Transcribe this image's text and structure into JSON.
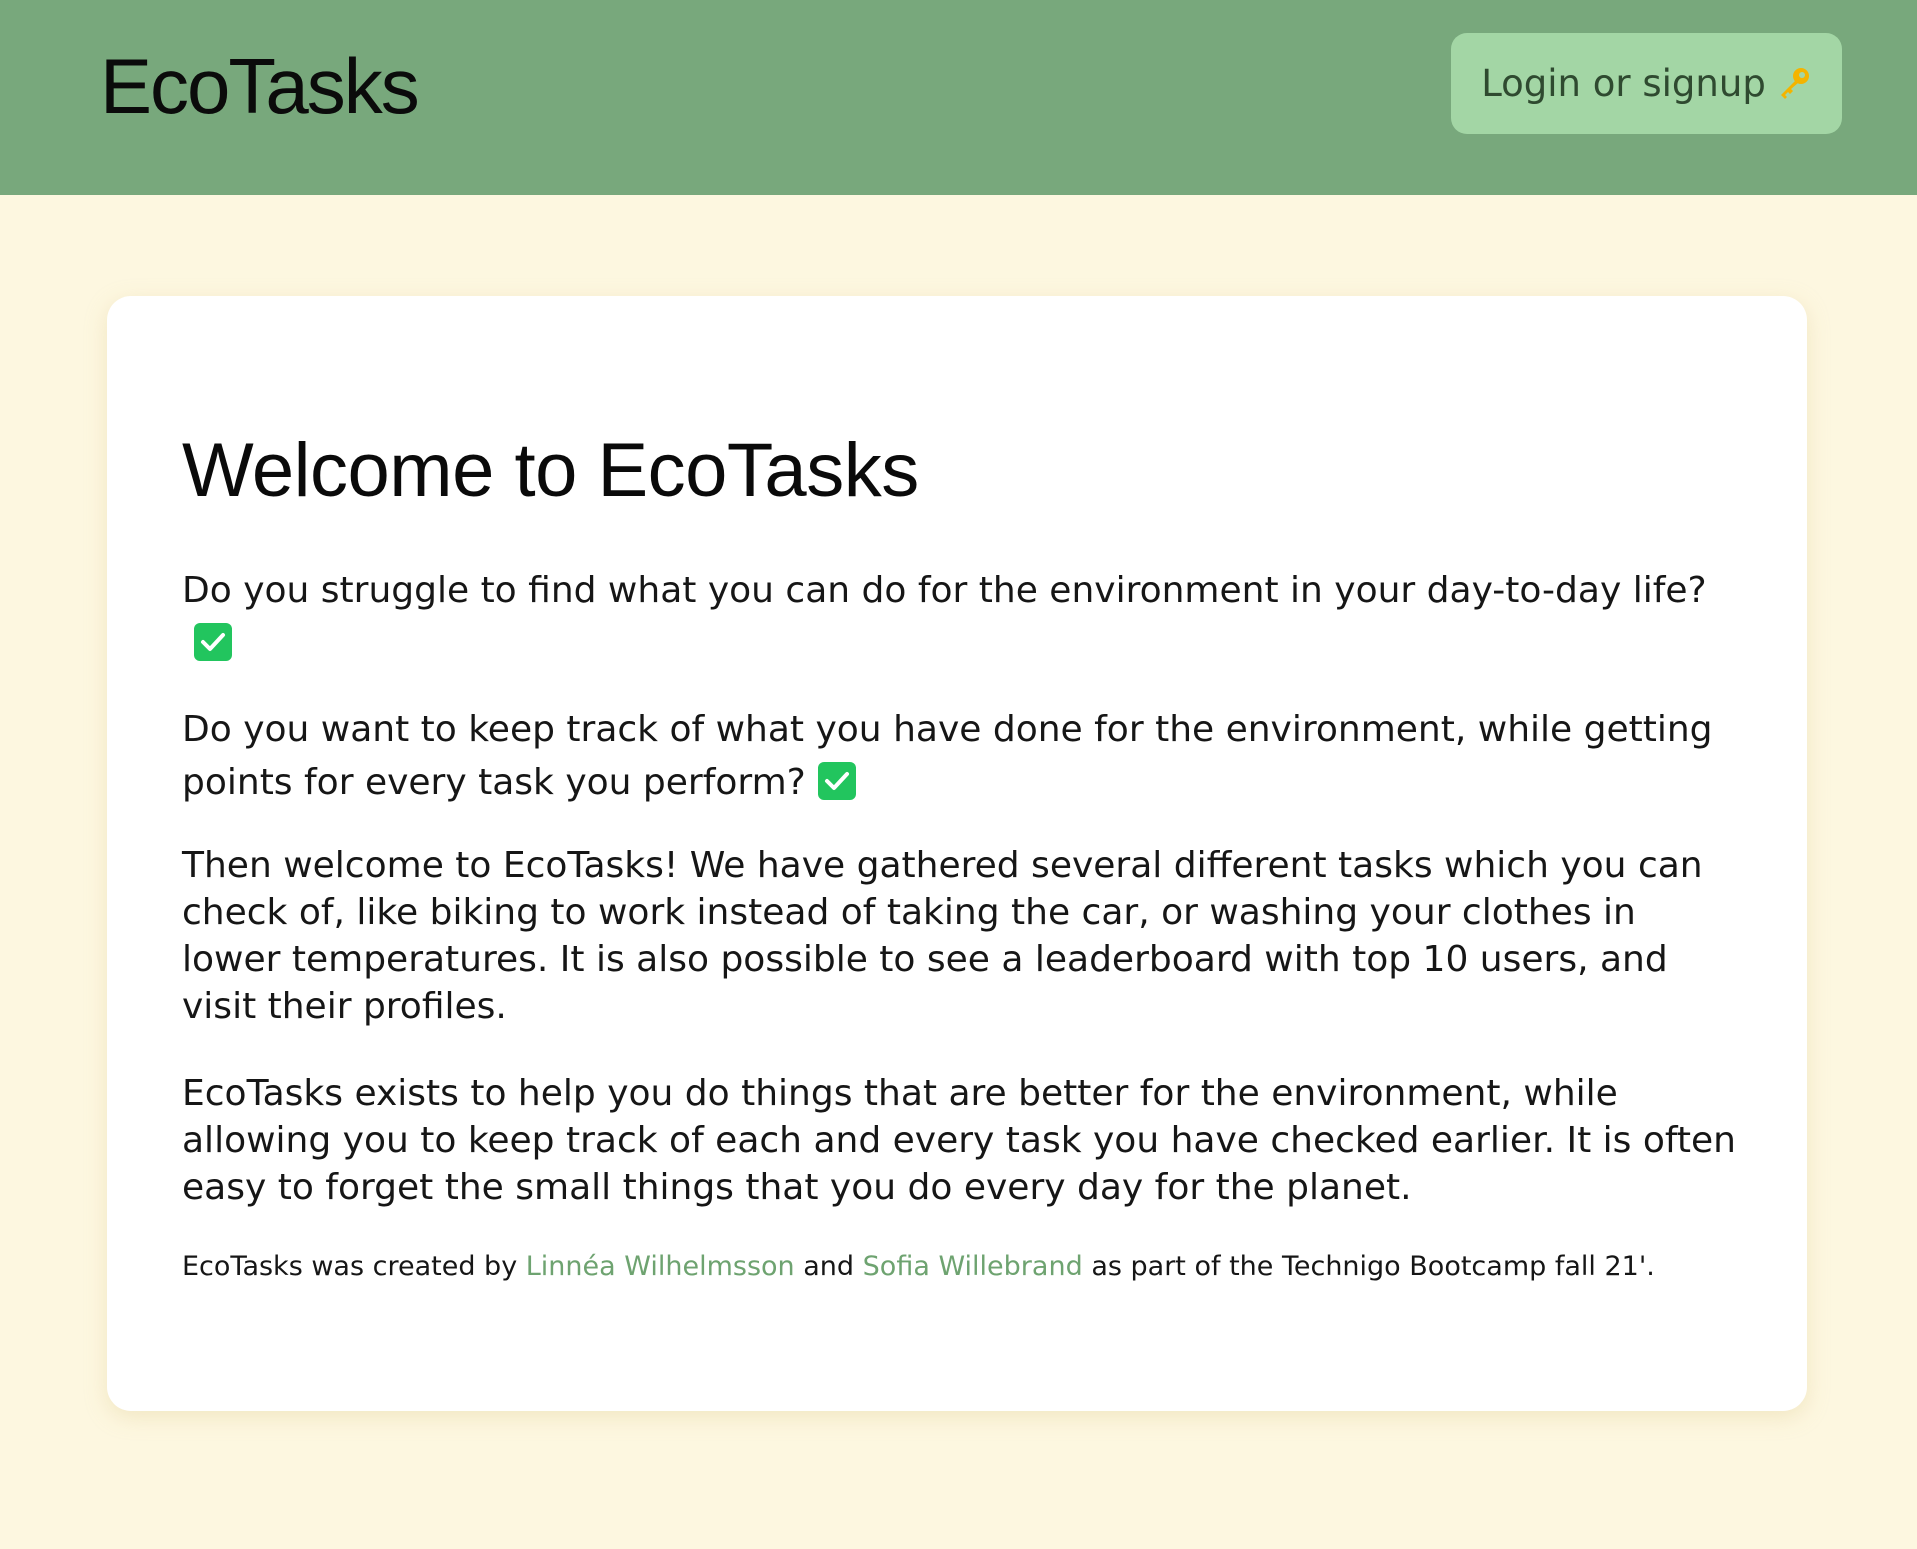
{
  "header": {
    "logo": "EcoTasks",
    "login_label": "Login or signup",
    "login_icon": "key-icon",
    "background_color": "#78a87c",
    "button_color": "#a3d6a5"
  },
  "main": {
    "title": "Welcome to EcoTasks",
    "paragraphs": [
      {
        "text": "Do you struggle to find what you can do for the environment in your day-to-day life?",
        "icon": "checkmark-icon"
      },
      {
        "text": "Do you want to keep track of what you have done for the environment, while getting points for every task you perform?",
        "icon": "checkmark-icon"
      },
      {
        "text": "Then welcome to EcoTasks! We have gathered several different tasks which you can check of, like biking to work instead of taking the car, or washing your clothes in lower temperatures. It is also possible to see a leaderboard with top 10 users, and visit their profiles."
      },
      {
        "text": "EcoTasks exists to help you do things that are better for the environment, while allowing you to keep track of each and every task you have checked earlier. It is often easy to forget the small things that you do every day for the planet."
      }
    ],
    "credits": {
      "prefix": "EcoTasks was created by",
      "author_1": "Linnéa Wilhelmsson",
      "conjunction": "and",
      "author_2": "Sofia Willebrand",
      "suffix": "as part of the Technigo Bootcamp fall 21'."
    }
  },
  "colors": {
    "page_background": "#fdf7e0",
    "card_background": "#ffffff",
    "link_color": "#6ea370",
    "check_color": "#22c55e"
  }
}
